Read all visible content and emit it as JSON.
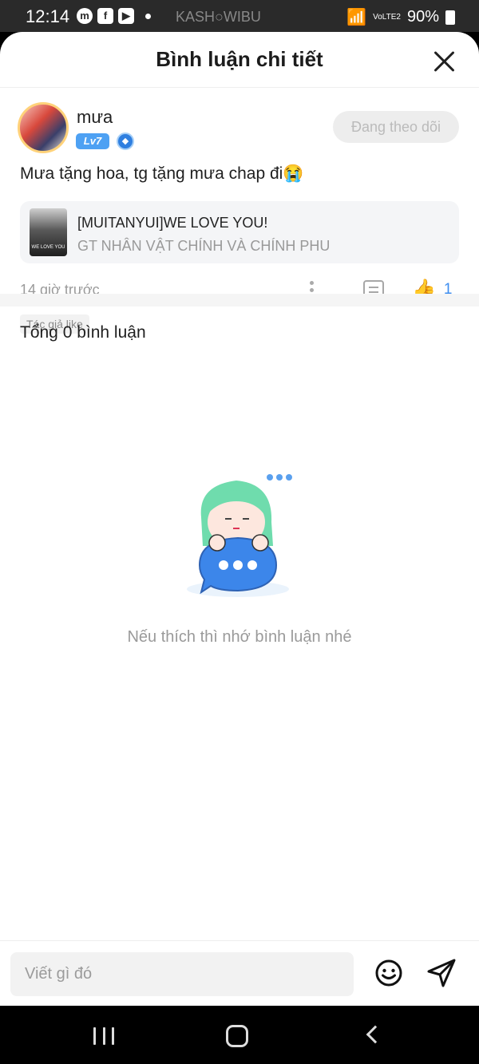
{
  "status_bar": {
    "time": "12:14",
    "channel_text": "KASH○WIBU",
    "battery": "90%",
    "network": "VoLTE2"
  },
  "header": {
    "title": "Bình luận chi tiết",
    "close_icon": "close-icon"
  },
  "comment": {
    "username": "mưa",
    "level": "Lv7",
    "follow_label": "Đang theo dõi",
    "text": "Mưa tặng hoa, tg tặng mưa chap đi😭",
    "reference": {
      "title": "[MUITANYUI]WE LOVE YOU!",
      "subtitle": "GT NHÂN VẬT CHÍNH VÀ CHÍNH PHU",
      "thumb_text": "WE LOVE YOU"
    },
    "time": "14 giờ trước",
    "like_count": "1",
    "author_tag": "Tác giả like"
  },
  "total_comments_label": "Tổng 0 bình luận",
  "empty_hint": "Nếu thích thì nhớ bình luận nhé",
  "input": {
    "placeholder": "Viết gì đó",
    "value": ""
  },
  "colors": {
    "accent": "#3e8ef0",
    "level_badge": "#4ea1f3",
    "mascot_hair": "#6fdcad",
    "mascot_bubble": "#3c86ea"
  }
}
